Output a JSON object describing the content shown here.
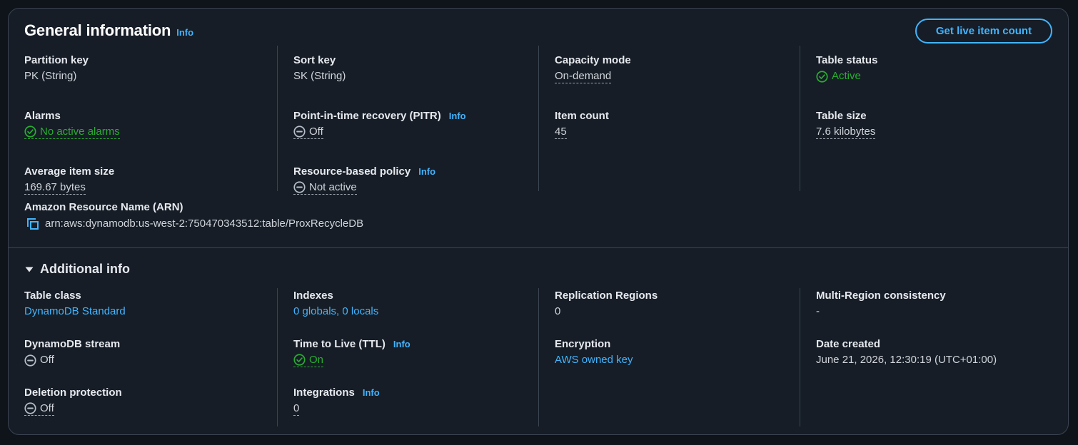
{
  "general": {
    "title": "General information",
    "info": "Info",
    "live_button": "Get live item count",
    "partition_key": {
      "label": "Partition key",
      "value": "PK (String)"
    },
    "sort_key": {
      "label": "Sort key",
      "value": "SK (String)"
    },
    "capacity_mode": {
      "label": "Capacity mode",
      "value": "On-demand"
    },
    "table_status": {
      "label": "Table status",
      "value": "Active"
    },
    "alarms": {
      "label": "Alarms",
      "value": "No active alarms"
    },
    "pitr": {
      "label": "Point-in-time recovery (PITR)",
      "info": "Info",
      "value": "Off"
    },
    "item_count": {
      "label": "Item count",
      "value": "45"
    },
    "table_size": {
      "label": "Table size",
      "value": "7.6 kilobytes"
    },
    "avg_item_size": {
      "label": "Average item size",
      "value": "169.67 bytes"
    },
    "resource_policy": {
      "label": "Resource-based policy",
      "info": "Info",
      "value": "Not active"
    },
    "arn": {
      "label": "Amazon Resource Name (ARN)",
      "value": "arn:aws:dynamodb:us-west-2:750470343512:table/ProxRecycleDB"
    }
  },
  "additional": {
    "title": "Additional info",
    "table_class": {
      "label": "Table class",
      "value": "DynamoDB Standard"
    },
    "indexes": {
      "label": "Indexes",
      "value": "0 globals, 0 locals"
    },
    "replication": {
      "label": "Replication Regions",
      "value": "0"
    },
    "multi_region": {
      "label": "Multi-Region consistency",
      "value": "-"
    },
    "stream": {
      "label": "DynamoDB stream",
      "value": "Off"
    },
    "ttl": {
      "label": "Time to Live (TTL)",
      "info": "Info",
      "value": "On"
    },
    "encryption": {
      "label": "Encryption",
      "value": "AWS owned key"
    },
    "date_created": {
      "label": "Date created",
      "value": "June 21, 2026, 12:30:19 (UTC+01:00)"
    },
    "deletion_protection": {
      "label": "Deletion protection",
      "value": "Off"
    },
    "integrations": {
      "label": "Integrations",
      "info": "Info",
      "value": "0"
    }
  },
  "icons": {
    "success": "check-circle-icon",
    "off": "minus-circle-icon",
    "copy": "copy-icon",
    "expand": "caret-down-icon"
  },
  "colors": {
    "accent": "#42b4ff",
    "success": "#29ad32",
    "background": "#161d26",
    "border": "#3b4452"
  }
}
